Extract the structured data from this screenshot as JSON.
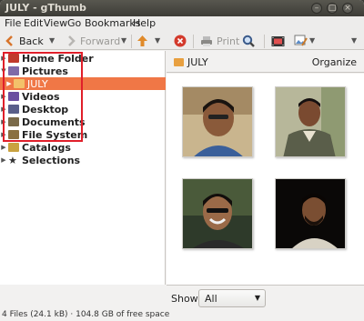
{
  "window": {
    "title": "JULY - gThumb"
  },
  "menu": [
    "File",
    "Edit",
    "View",
    "Go",
    "Bookmarks",
    "Help"
  ],
  "toolbar": {
    "back_label": "Back",
    "forward_label": "Forward",
    "print_label": "Print"
  },
  "tree": {
    "items": [
      {
        "label": "Home Folder",
        "color": "#c0392b"
      },
      {
        "label": "Pictures",
        "color": "#7f6aa8"
      },
      {
        "label": "JULY",
        "color": "#e8a040"
      },
      {
        "label": "Videos",
        "color": "#6b4ea0"
      },
      {
        "label": "Desktop",
        "color": "#5a5f8a"
      },
      {
        "label": "Documents",
        "color": "#7a6a4a"
      },
      {
        "label": "File System",
        "color": "#8a7040"
      },
      {
        "label": "Catalogs",
        "color": "#c9a23f"
      },
      {
        "label": "Selections",
        "color": "#333333"
      }
    ]
  },
  "location": {
    "folder": "JULY",
    "organize_label": "Organize"
  },
  "show": {
    "label": "Show:",
    "value": "All"
  },
  "status": {
    "text": "4 Files (24.1 kB) · 104.8 GB of free space"
  },
  "colors": {
    "accent": "#f07746",
    "highlight": "#e01f2a"
  }
}
